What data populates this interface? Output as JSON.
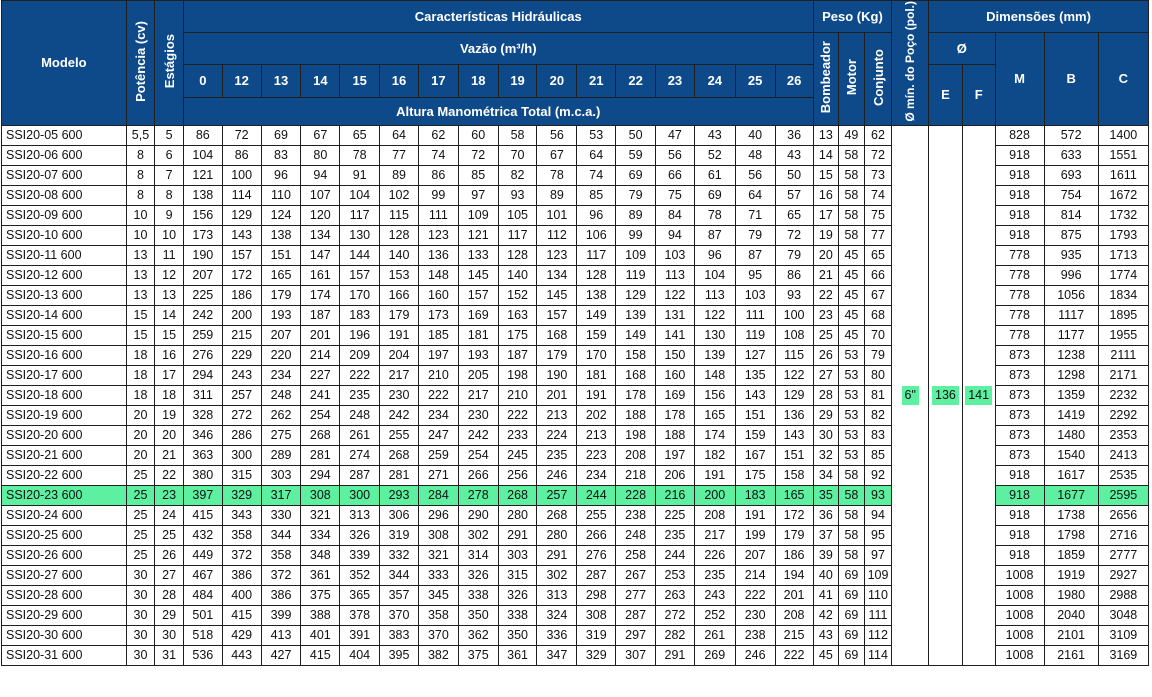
{
  "header": {
    "modelo": "Modelo",
    "potencia": "Potência (cv)",
    "estagios": "Estágios",
    "caracteristicas": "Características Hidráulicas",
    "vazao": "Vazão (m³/h)",
    "altura": "Altura Manométrica Total (m.c.a.)",
    "peso": "Peso (Kg)",
    "bombeador": "Bombeador",
    "motor": "Motor",
    "conjunto": "Conjunto",
    "poco": "Ø mín. do Poço (pol.)",
    "dimensoes": "Dimensões (mm)",
    "phi": "Ø",
    "e": "E",
    "f": "F",
    "m": "M",
    "b": "B",
    "c": "C",
    "flows": [
      "0",
      "12",
      "13",
      "14",
      "15",
      "16",
      "17",
      "18",
      "19",
      "20",
      "21",
      "22",
      "23",
      "24",
      "25",
      "26"
    ]
  },
  "shared": {
    "poco": "6\"",
    "e": "136",
    "f": "141"
  },
  "highlight_row": 18,
  "rows": [
    [
      "SSI20-05 600",
      "5,5",
      "5",
      "86",
      "72",
      "69",
      "67",
      "65",
      "64",
      "62",
      "60",
      "58",
      "56",
      "53",
      "50",
      "47",
      "43",
      "40",
      "36",
      "13",
      "49",
      "62",
      "828",
      "572",
      "1400"
    ],
    [
      "SSI20-06 600",
      "8",
      "6",
      "104",
      "86",
      "83",
      "80",
      "78",
      "77",
      "74",
      "72",
      "70",
      "67",
      "64",
      "59",
      "56",
      "52",
      "48",
      "43",
      "14",
      "58",
      "72",
      "918",
      "633",
      "1551"
    ],
    [
      "SSI20-07 600",
      "8",
      "7",
      "121",
      "100",
      "96",
      "94",
      "91",
      "89",
      "86",
      "85",
      "82",
      "78",
      "74",
      "69",
      "66",
      "61",
      "56",
      "50",
      "15",
      "58",
      "73",
      "918",
      "693",
      "1611"
    ],
    [
      "SSI20-08 600",
      "8",
      "8",
      "138",
      "114",
      "110",
      "107",
      "104",
      "102",
      "99",
      "97",
      "93",
      "89",
      "85",
      "79",
      "75",
      "69",
      "64",
      "57",
      "16",
      "58",
      "74",
      "918",
      "754",
      "1672"
    ],
    [
      "SSI20-09 600",
      "10",
      "9",
      "156",
      "129",
      "124",
      "120",
      "117",
      "115",
      "111",
      "109",
      "105",
      "101",
      "96",
      "89",
      "84",
      "78",
      "71",
      "65",
      "17",
      "58",
      "75",
      "918",
      "814",
      "1732"
    ],
    [
      "SSI20-10 600",
      "10",
      "10",
      "173",
      "143",
      "138",
      "134",
      "130",
      "128",
      "123",
      "121",
      "117",
      "112",
      "106",
      "99",
      "94",
      "87",
      "79",
      "72",
      "19",
      "58",
      "77",
      "918",
      "875",
      "1793"
    ],
    [
      "SSI20-11 600",
      "13",
      "11",
      "190",
      "157",
      "151",
      "147",
      "144",
      "140",
      "136",
      "133",
      "128",
      "123",
      "117",
      "109",
      "103",
      "96",
      "87",
      "79",
      "20",
      "45",
      "65",
      "778",
      "935",
      "1713"
    ],
    [
      "SSI20-12 600",
      "13",
      "12",
      "207",
      "172",
      "165",
      "161",
      "157",
      "153",
      "148",
      "145",
      "140",
      "134",
      "128",
      "119",
      "113",
      "104",
      "95",
      "86",
      "21",
      "45",
      "66",
      "778",
      "996",
      "1774"
    ],
    [
      "SSI20-13 600",
      "13",
      "13",
      "225",
      "186",
      "179",
      "174",
      "170",
      "166",
      "160",
      "157",
      "152",
      "145",
      "138",
      "129",
      "122",
      "113",
      "103",
      "93",
      "22",
      "45",
      "67",
      "778",
      "1056",
      "1834"
    ],
    [
      "SSI20-14 600",
      "15",
      "14",
      "242",
      "200",
      "193",
      "187",
      "183",
      "179",
      "173",
      "169",
      "163",
      "157",
      "149",
      "139",
      "131",
      "122",
      "111",
      "100",
      "23",
      "45",
      "68",
      "778",
      "1117",
      "1895"
    ],
    [
      "SSI20-15 600",
      "15",
      "15",
      "259",
      "215",
      "207",
      "201",
      "196",
      "191",
      "185",
      "181",
      "175",
      "168",
      "159",
      "149",
      "141",
      "130",
      "119",
      "108",
      "25",
      "45",
      "70",
      "778",
      "1177",
      "1955"
    ],
    [
      "SSI20-16 600",
      "18",
      "16",
      "276",
      "229",
      "220",
      "214",
      "209",
      "204",
      "197",
      "193",
      "187",
      "179",
      "170",
      "158",
      "150",
      "139",
      "127",
      "115",
      "26",
      "53",
      "79",
      "873",
      "1238",
      "2111"
    ],
    [
      "SSI20-17 600",
      "18",
      "17",
      "294",
      "243",
      "234",
      "227",
      "222",
      "217",
      "210",
      "205",
      "198",
      "190",
      "181",
      "168",
      "160",
      "148",
      "135",
      "122",
      "27",
      "53",
      "80",
      "873",
      "1298",
      "2171"
    ],
    [
      "SSI20-18 600",
      "18",
      "18",
      "311",
      "257",
      "248",
      "241",
      "235",
      "230",
      "222",
      "217",
      "210",
      "201",
      "191",
      "178",
      "169",
      "156",
      "143",
      "129",
      "28",
      "53",
      "81",
      "873",
      "1359",
      "2232"
    ],
    [
      "SSI20-19 600",
      "20",
      "19",
      "328",
      "272",
      "262",
      "254",
      "248",
      "242",
      "234",
      "230",
      "222",
      "213",
      "202",
      "188",
      "178",
      "165",
      "151",
      "136",
      "29",
      "53",
      "82",
      "873",
      "1419",
      "2292"
    ],
    [
      "SSI20-20 600",
      "20",
      "20",
      "346",
      "286",
      "275",
      "268",
      "261",
      "255",
      "247",
      "242",
      "233",
      "224",
      "213",
      "198",
      "188",
      "174",
      "159",
      "143",
      "30",
      "53",
      "83",
      "873",
      "1480",
      "2353"
    ],
    [
      "SSI20-21 600",
      "20",
      "21",
      "363",
      "300",
      "289",
      "281",
      "274",
      "268",
      "259",
      "254",
      "245",
      "235",
      "223",
      "208",
      "197",
      "182",
      "167",
      "151",
      "32",
      "53",
      "85",
      "873",
      "1540",
      "2413"
    ],
    [
      "SSI20-22 600",
      "25",
      "22",
      "380",
      "315",
      "303",
      "294",
      "287",
      "281",
      "271",
      "266",
      "256",
      "246",
      "234",
      "218",
      "206",
      "191",
      "175",
      "158",
      "34",
      "58",
      "92",
      "918",
      "1617",
      "2535"
    ],
    [
      "SSI20-23 600",
      "25",
      "23",
      "397",
      "329",
      "317",
      "308",
      "300",
      "293",
      "284",
      "278",
      "268",
      "257",
      "244",
      "228",
      "216",
      "200",
      "183",
      "165",
      "35",
      "58",
      "93",
      "918",
      "1677",
      "2595"
    ],
    [
      "SSI20-24 600",
      "25",
      "24",
      "415",
      "343",
      "330",
      "321",
      "313",
      "306",
      "296",
      "290",
      "280",
      "268",
      "255",
      "238",
      "225",
      "208",
      "191",
      "172",
      "36",
      "58",
      "94",
      "918",
      "1738",
      "2656"
    ],
    [
      "SSI20-25 600",
      "25",
      "25",
      "432",
      "358",
      "344",
      "334",
      "326",
      "319",
      "308",
      "302",
      "291",
      "280",
      "266",
      "248",
      "235",
      "217",
      "199",
      "179",
      "37",
      "58",
      "95",
      "918",
      "1798",
      "2716"
    ],
    [
      "SSI20-26 600",
      "25",
      "26",
      "449",
      "372",
      "358",
      "348",
      "339",
      "332",
      "321",
      "314",
      "303",
      "291",
      "276",
      "258",
      "244",
      "226",
      "207",
      "186",
      "39",
      "58",
      "97",
      "918",
      "1859",
      "2777"
    ],
    [
      "SSI20-27 600",
      "30",
      "27",
      "467",
      "386",
      "372",
      "361",
      "352",
      "344",
      "333",
      "326",
      "315",
      "302",
      "287",
      "267",
      "253",
      "235",
      "214",
      "194",
      "40",
      "69",
      "109",
      "1008",
      "1919",
      "2927"
    ],
    [
      "SSI20-28 600",
      "30",
      "28",
      "484",
      "400",
      "386",
      "375",
      "365",
      "357",
      "345",
      "338",
      "326",
      "313",
      "298",
      "277",
      "263",
      "243",
      "222",
      "201",
      "41",
      "69",
      "110",
      "1008",
      "1980",
      "2988"
    ],
    [
      "SSI20-29 600",
      "30",
      "29",
      "501",
      "415",
      "399",
      "388",
      "378",
      "370",
      "358",
      "350",
      "338",
      "324",
      "308",
      "287",
      "272",
      "252",
      "230",
      "208",
      "42",
      "69",
      "111",
      "1008",
      "2040",
      "3048"
    ],
    [
      "SSI20-30 600",
      "30",
      "30",
      "518",
      "429",
      "413",
      "401",
      "391",
      "383",
      "370",
      "362",
      "350",
      "336",
      "319",
      "297",
      "282",
      "261",
      "238",
      "215",
      "43",
      "69",
      "112",
      "1008",
      "2101",
      "3109"
    ],
    [
      "SSI20-31 600",
      "30",
      "31",
      "536",
      "443",
      "427",
      "415",
      "404",
      "395",
      "382",
      "375",
      "361",
      "347",
      "329",
      "307",
      "291",
      "269",
      "246",
      "222",
      "45",
      "69",
      "114",
      "1008",
      "2161",
      "3169"
    ]
  ]
}
